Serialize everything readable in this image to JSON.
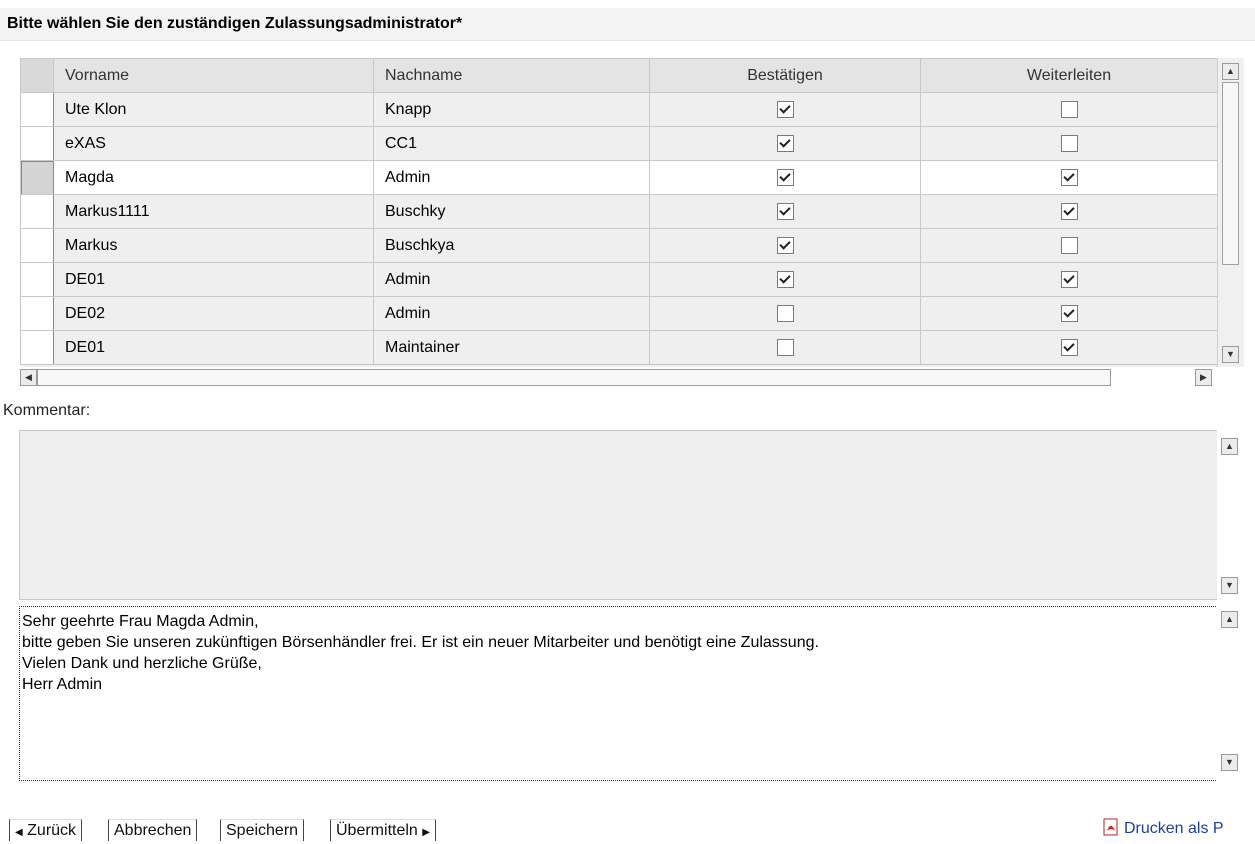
{
  "title": "Bitte wählen Sie den zuständigen Zulassungsadministrator*",
  "grid": {
    "columns": [
      "Vorname",
      "Nachname",
      "Bestätigen",
      "Weiterleiten"
    ],
    "rows": [
      {
        "vorname": "Ute Klon",
        "nachname": "Knapp",
        "bestaetigen": true,
        "weiterleiten": false,
        "selected": false
      },
      {
        "vorname": "eXAS",
        "nachname": "CC1",
        "bestaetigen": true,
        "weiterleiten": false,
        "selected": false
      },
      {
        "vorname": "Magda",
        "nachname": "Admin",
        "bestaetigen": true,
        "weiterleiten": true,
        "selected": true
      },
      {
        "vorname": "Markus1111",
        "nachname": "Buschky",
        "bestaetigen": true,
        "weiterleiten": true,
        "selected": false
      },
      {
        "vorname": "Markus",
        "nachname": "Buschkya",
        "bestaetigen": true,
        "weiterleiten": false,
        "selected": false
      },
      {
        "vorname": "DE01",
        "nachname": "Admin",
        "bestaetigen": true,
        "weiterleiten": true,
        "selected": false
      },
      {
        "vorname": "DE02",
        "nachname": "Admin",
        "bestaetigen": false,
        "weiterleiten": true,
        "selected": false
      },
      {
        "vorname": "DE01",
        "nachname": "Maintainer",
        "bestaetigen": false,
        "weiterleiten": true,
        "selected": false
      }
    ]
  },
  "comment": {
    "label": "Kommentar:",
    "input_value": "",
    "message": "Sehr geehrte Frau Magda Admin,\nbitte geben Sie unseren zukünftigen Börsenhändler frei. Er ist ein neuer Mitarbeiter und benötigt eine Zulassung.\nVielen Dank und herzliche Grüße,\nHerr Admin"
  },
  "footer": {
    "back": "Zurück",
    "cancel": "Abbrechen",
    "save": "Speichern",
    "submit": "Übermitteln",
    "print": "Drucken als P"
  },
  "icons": {
    "scroll_up": "arrow-up-icon",
    "scroll_down": "arrow-down-icon",
    "scroll_left": "arrow-left-icon",
    "scroll_right": "arrow-right-icon",
    "pdf": "pdf-icon"
  },
  "colors": {
    "link": "#1a3fa8",
    "grid_bg": "#efefef",
    "selected_row_bg": "#ffffff"
  }
}
